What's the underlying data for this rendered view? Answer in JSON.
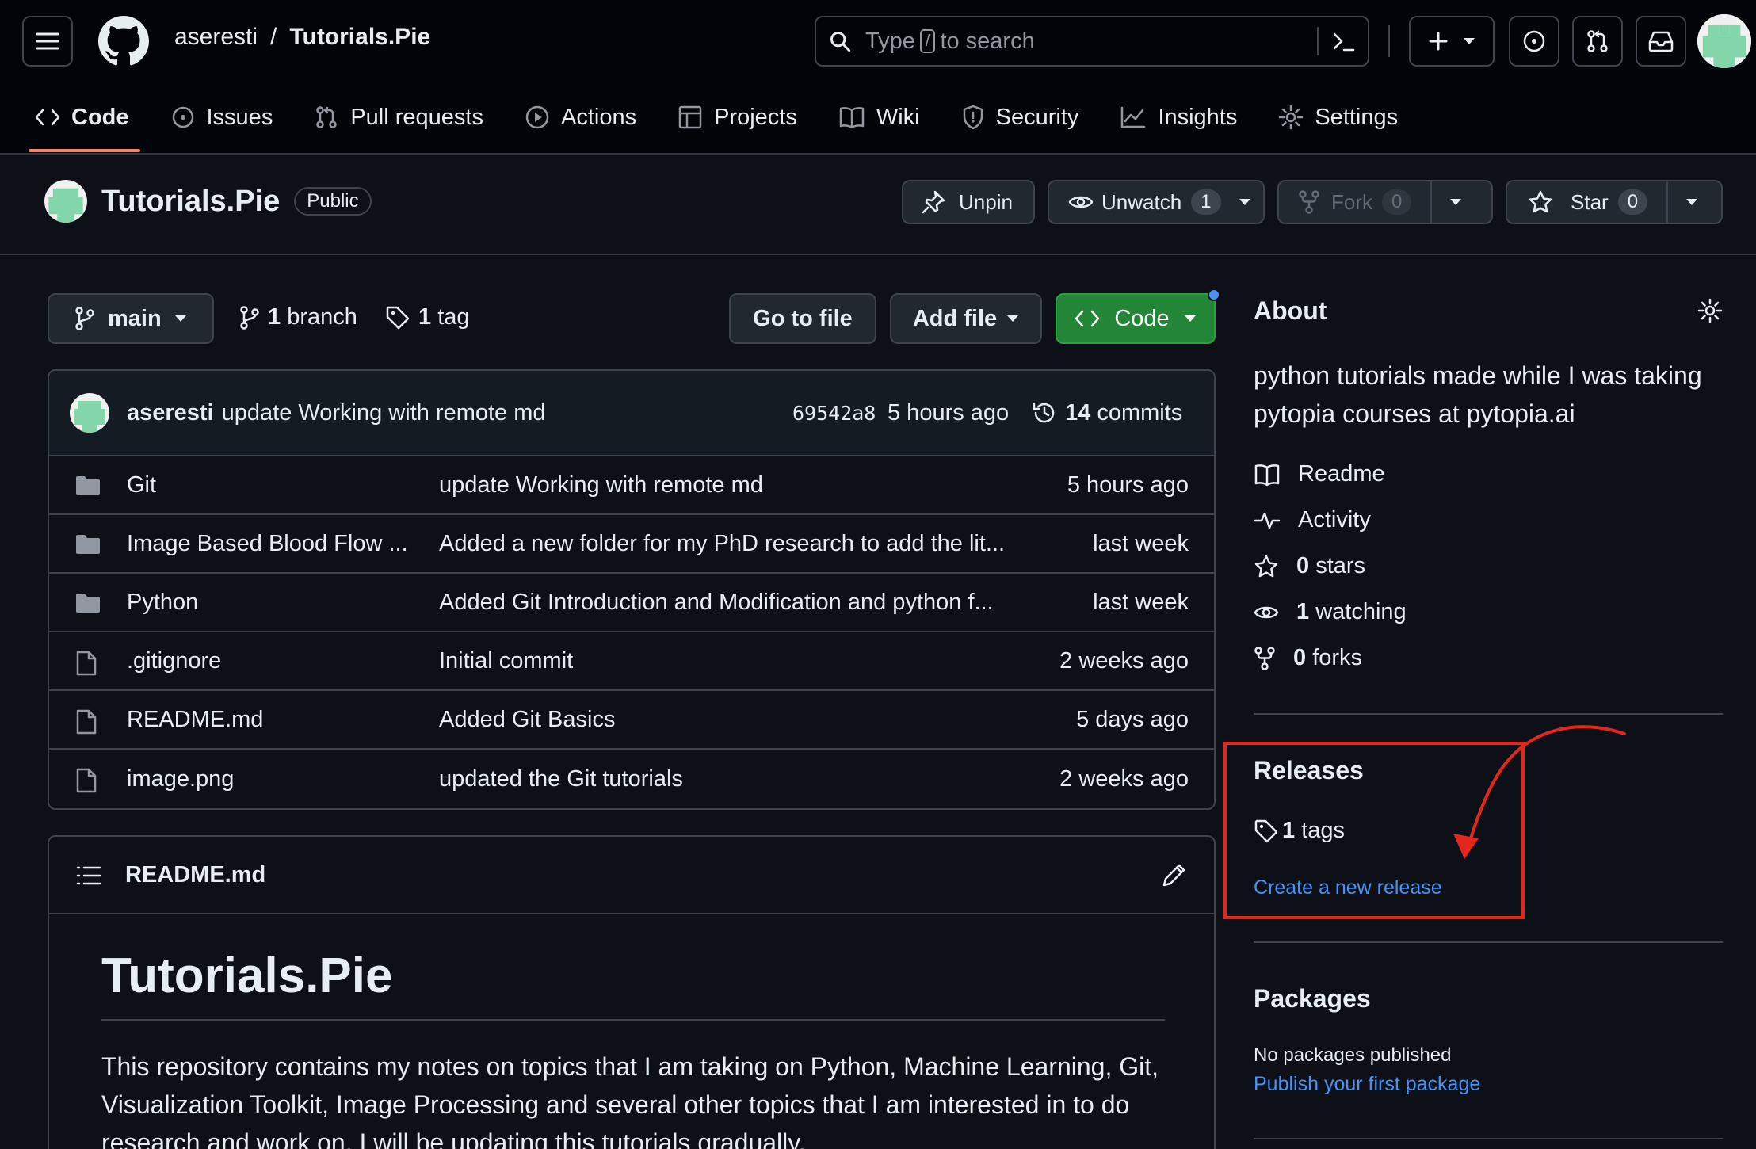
{
  "header": {
    "owner": "aseresti",
    "separator": "/",
    "repo": "Tutorials.Pie",
    "search_prefix": "Type",
    "search_key": "/",
    "search_suffix": "to search"
  },
  "tabs": [
    {
      "label": "Code",
      "icon": "code-icon"
    },
    {
      "label": "Issues",
      "icon": "issue-icon"
    },
    {
      "label": "Pull requests",
      "icon": "pull-request-icon"
    },
    {
      "label": "Actions",
      "icon": "play-icon"
    },
    {
      "label": "Projects",
      "icon": "table-icon"
    },
    {
      "label": "Wiki",
      "icon": "book-icon"
    },
    {
      "label": "Security",
      "icon": "shield-icon"
    },
    {
      "label": "Insights",
      "icon": "graph-icon"
    },
    {
      "label": "Settings",
      "icon": "gear-icon"
    }
  ],
  "repo": {
    "name": "Tutorials.Pie",
    "visibility": "Public",
    "unpin": "Unpin",
    "unwatch": "Unwatch",
    "watch_count": "1",
    "fork": "Fork",
    "fork_count": "0",
    "star": "Star",
    "star_count": "0"
  },
  "toolbar": {
    "branch": "main",
    "branches_count": "1",
    "branches_label": "branch",
    "tags_count": "1",
    "tags_label": "tag",
    "go_to_file": "Go to file",
    "add_file": "Add file",
    "code": "Code"
  },
  "commit": {
    "author": "aseresti",
    "message": "update Working with remote md",
    "sha": "69542a8",
    "time": "5 hours ago",
    "commits_count": "14",
    "commits_label": "commits"
  },
  "files": [
    {
      "type": "folder",
      "name": "Git",
      "message": "update Working with remote md",
      "date": "5 hours ago"
    },
    {
      "type": "folder",
      "name": "Image Based Blood Flow ...",
      "message": "Added a new folder for my PhD research to add the lit...",
      "date": "last week"
    },
    {
      "type": "folder",
      "name": "Python",
      "message": "Added Git Introduction and Modification and python f...",
      "date": "last week"
    },
    {
      "type": "file",
      "name": ".gitignore",
      "message": "Initial commit",
      "date": "2 weeks ago"
    },
    {
      "type": "file",
      "name": "README.md",
      "message": "Added Git Basics",
      "date": "5 days ago"
    },
    {
      "type": "file",
      "name": "image.png",
      "message": "updated the Git tutorials",
      "date": "2 weeks ago"
    }
  ],
  "readme": {
    "filename": "README.md",
    "title": "Tutorials.Pie",
    "body": "This repository contains my notes on topics that I am taking on Python, Machine Learning, Git, Visualization Toolkit, Image Processing and several other topics that I am interested in to do research and work on. I will be updating this tutorials gradually."
  },
  "about": {
    "heading": "About",
    "description": "python tutorials made while I was taking pytopia courses at pytopia.ai",
    "readme": "Readme",
    "activity": "Activity",
    "stars_count": "0",
    "stars_label": "stars",
    "watching_count": "1",
    "watching_label": "watching",
    "forks_count": "0",
    "forks_label": "forks"
  },
  "releases": {
    "heading": "Releases",
    "tags_count": "1",
    "tags_label": "tags",
    "create_link": "Create a new release"
  },
  "packages": {
    "heading": "Packages",
    "empty": "No packages published",
    "publish_link": "Publish your first package"
  },
  "colors": {
    "background": "#0d1117",
    "header": "#010409",
    "border": "#3d444d",
    "accent_green": "#238636",
    "link_blue": "#4493f8",
    "tab_underline": "#f78166",
    "annotation_red": "#e5261d"
  }
}
